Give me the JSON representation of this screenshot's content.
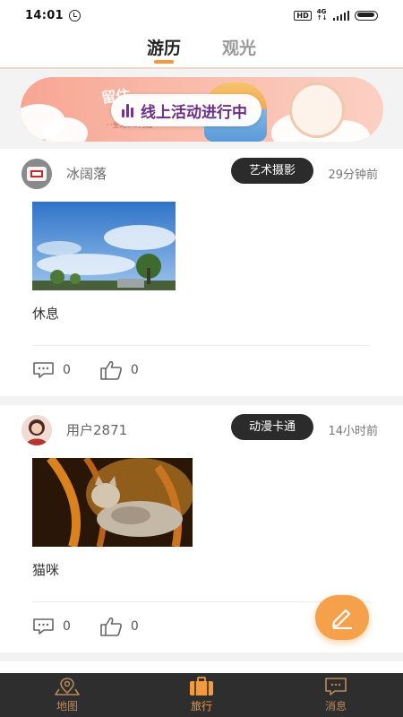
{
  "status_bar": {
    "time": "14:01",
    "network_label": "4G",
    "hd_label": "HD"
  },
  "tabs": [
    {
      "label": "游历",
      "active": true
    },
    {
      "label": "观光",
      "active": false
    }
  ],
  "banner": {
    "pill_text": "线上活动进行中",
    "deco_text": "留住",
    "deco_sub": "···全场9.9元起···"
  },
  "posts": [
    {
      "username": "冰阔落",
      "tag": "艺术摄影",
      "time": "29分钟前",
      "caption": "休息",
      "comments": "0",
      "likes": "0",
      "photo": "sky-trees"
    },
    {
      "username": "用户2871",
      "tag": "动漫卡通",
      "time": "14小时前",
      "caption": "猫咪",
      "comments": "0",
      "likes": "0",
      "photo": "cat"
    }
  ],
  "bottom_nav": [
    {
      "label": "地图",
      "icon": "map-pin-icon",
      "active": false
    },
    {
      "label": "旅行",
      "icon": "suitcase-icon",
      "active": true
    },
    {
      "label": "消息",
      "icon": "message-icon",
      "active": false
    }
  ],
  "colors": {
    "accent": "#f39a3f",
    "tag_bg": "#2b2b2b",
    "nav_bg": "#2e2e2e",
    "pill_text": "#6b2f86"
  }
}
